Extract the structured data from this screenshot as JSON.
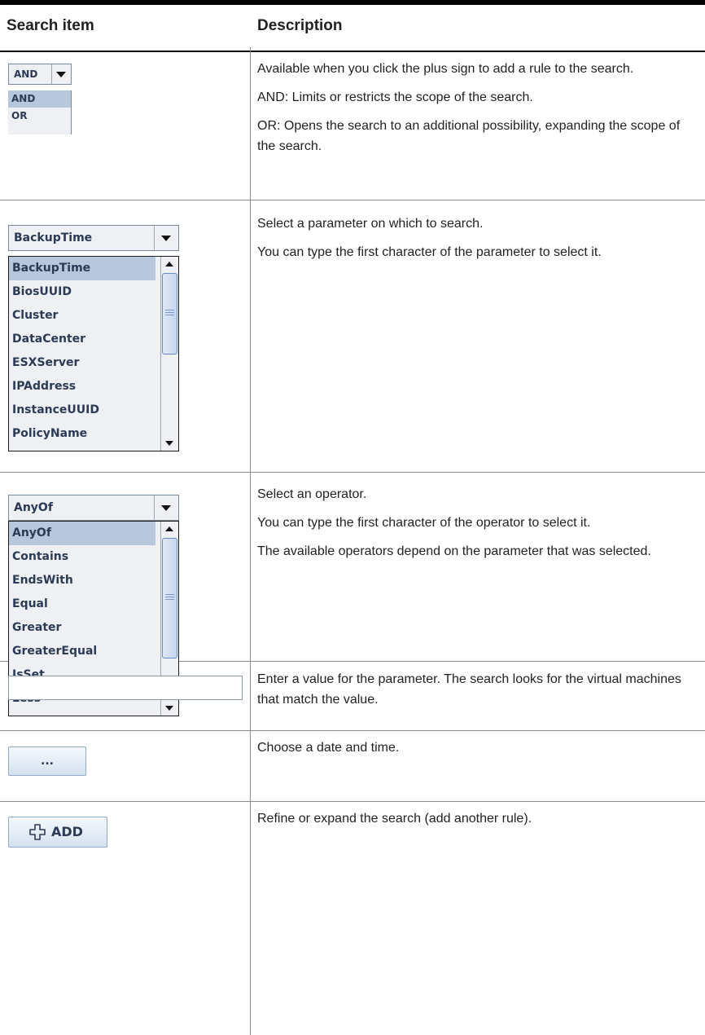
{
  "header": {
    "col1": "Search item",
    "col2": "Description"
  },
  "rows": [
    {
      "widget": {
        "value": "AND",
        "options": [
          "AND",
          "OR"
        ],
        "selected": "AND"
      },
      "desc": [
        "Available when you click the plus sign to add a rule to the search.",
        "AND: Limits or restricts the scope of the search.",
        "OR: Opens the search to an additional possibility, expanding the scope of the search."
      ]
    },
    {
      "widget": {
        "value": "BackupTime",
        "options": [
          "BackupTime",
          "BiosUUID",
          "Cluster",
          "DataCenter",
          "ESXServer",
          "IPAddress",
          "InstanceUUID",
          "PolicyName"
        ],
        "selected": "BackupTime"
      },
      "desc": [
        "Select a parameter on which to search.",
        "You can type the first character of the parameter to select it."
      ]
    },
    {
      "widget": {
        "value": "AnyOf",
        "options": [
          "AnyOf",
          "Contains",
          "EndsWith",
          "Equal",
          "Greater",
          "GreaterEqual",
          "IsSet",
          "Less"
        ],
        "selected": "AnyOf"
      },
      "desc": [
        "Select an operator.",
        "You can type the first character of the operator to select it.",
        "The available operators depend on the parameter that was selected."
      ]
    },
    {
      "widget": {
        "value": ""
      },
      "desc": [
        "Enter a value for the parameter. The search looks for the virtual machines that match the value."
      ]
    },
    {
      "widget": {
        "label": "..."
      },
      "desc": [
        "Choose a date and time."
      ]
    },
    {
      "widget": {
        "label": "ADD",
        "icon": "plus-outline-icon"
      },
      "desc": [
        "Refine or expand the search (add another rule)."
      ]
    }
  ]
}
